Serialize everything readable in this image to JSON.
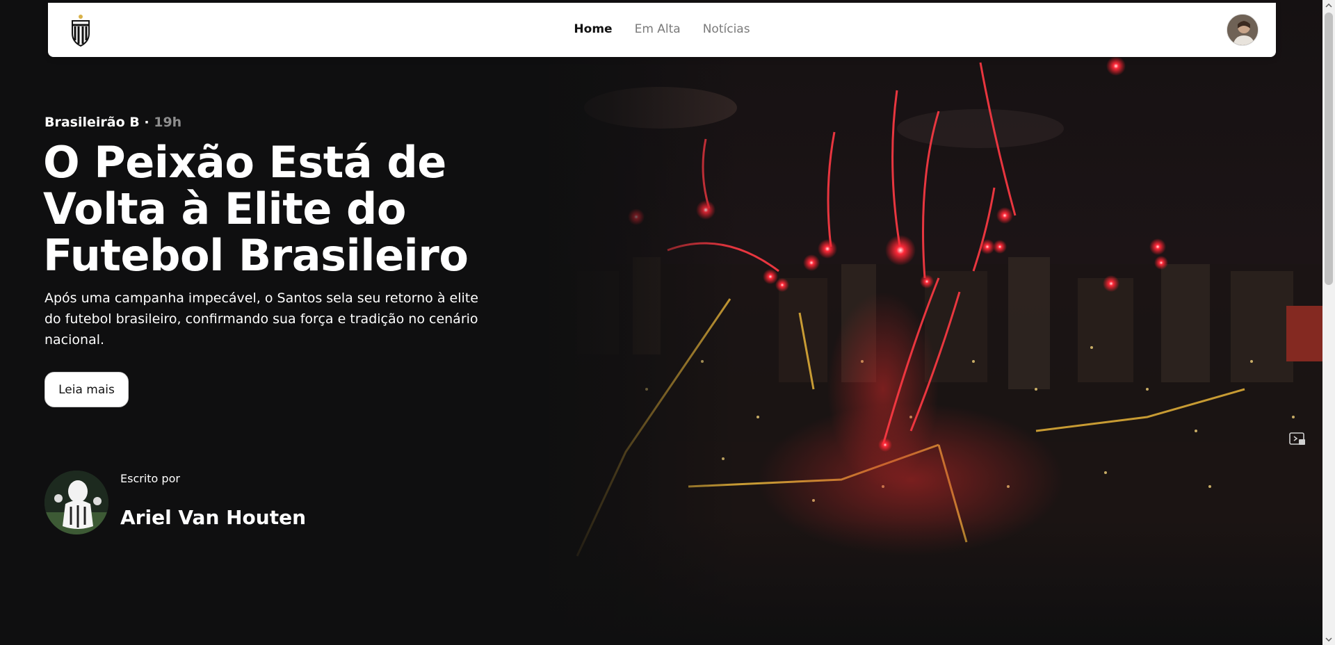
{
  "nav": {
    "links": [
      {
        "label": "Home",
        "active": true
      },
      {
        "label": "Em Alta",
        "active": false
      },
      {
        "label": "Notícias",
        "active": false
      }
    ],
    "logo_icon": "santos-crest-icon",
    "avatar_icon": "user-avatar"
  },
  "hero": {
    "category": "Brasileirão B",
    "separator": "·",
    "time": "19h",
    "title": "O Peixão Está de Volta à Elite do Futebol Brasileiro",
    "summary": "Após uma campanha impecável, o Santos sela seu retorno à elite do futebol brasileiro, confirmando sua força e tradição no cenário nacional.",
    "cta_label": "Leia mais",
    "image_icon": "city-fireworks-night-image"
  },
  "author": {
    "caption": "Escrito por",
    "name": "Ariel Van Houten",
    "avatar_icon": "mascot-photo"
  },
  "colors": {
    "background": "#0f0f10",
    "navbar": "#ffffff",
    "accent_red": "#ff2a3a",
    "muted": "#8e8e8e"
  }
}
